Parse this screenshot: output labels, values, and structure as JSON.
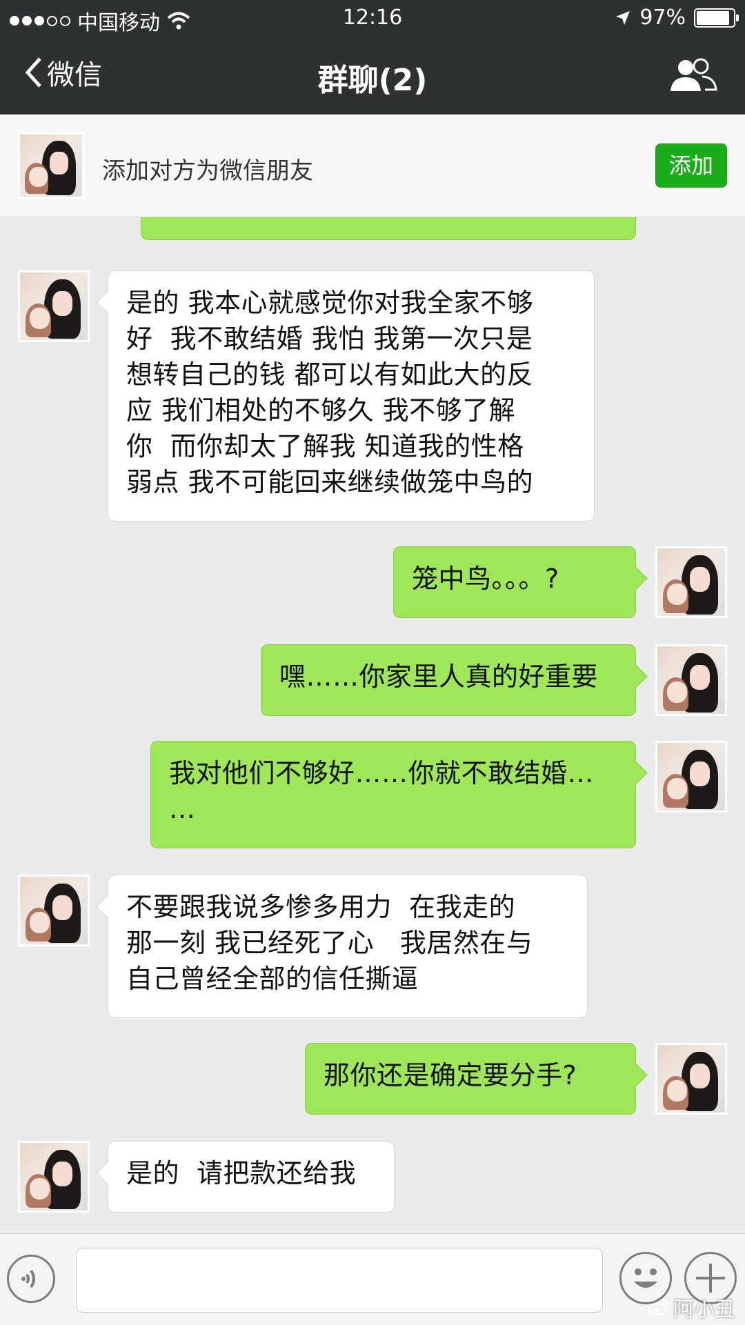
{
  "status_bar": {
    "carrier": "中国移动",
    "time": "12:16",
    "battery": "97%",
    "battery_level": 0.97
  },
  "nav": {
    "back_label": "微信",
    "title": "群聊(2)",
    "people_icon": "people-icon"
  },
  "banner": {
    "text": "添加对方为微信朋友",
    "add_label": "添加"
  },
  "messages": [
    {
      "from": "other",
      "text": "是的 我本心就感觉你对我全家不够\n好  我不敢结婚 我怕 我第一次只是\n想转自己的钱 都可以有如此大的反\n应 我们相处的不够久 我不够了解\n你  而你却太了解我 知道我的性格\n弱点 我不可能回来继续做笼中鸟的"
    },
    {
      "from": "me",
      "text": "笼中鸟。。。?"
    },
    {
      "from": "me",
      "text": "嘿……你家里人真的好重要"
    },
    {
      "from": "me",
      "text": "我对他们不够好……你就不敢结婚…\n…"
    },
    {
      "from": "other",
      "text": "不要跟我说多惨多用力  在我走的\n那一刻 我已经死了心   我居然在与\n自己曾经全部的信任撕逼"
    },
    {
      "from": "me",
      "text": "那你还是确定要分手?"
    },
    {
      "from": "other",
      "text": "是的  请把款还给我"
    }
  ],
  "watermark": "阿小丑",
  "colors": {
    "header_bg": "#2e3132",
    "chat_bg": "#ebebeb",
    "out_bubble": "#9fe658",
    "in_bubble": "#ffffff",
    "add_button": "#1aad19"
  }
}
